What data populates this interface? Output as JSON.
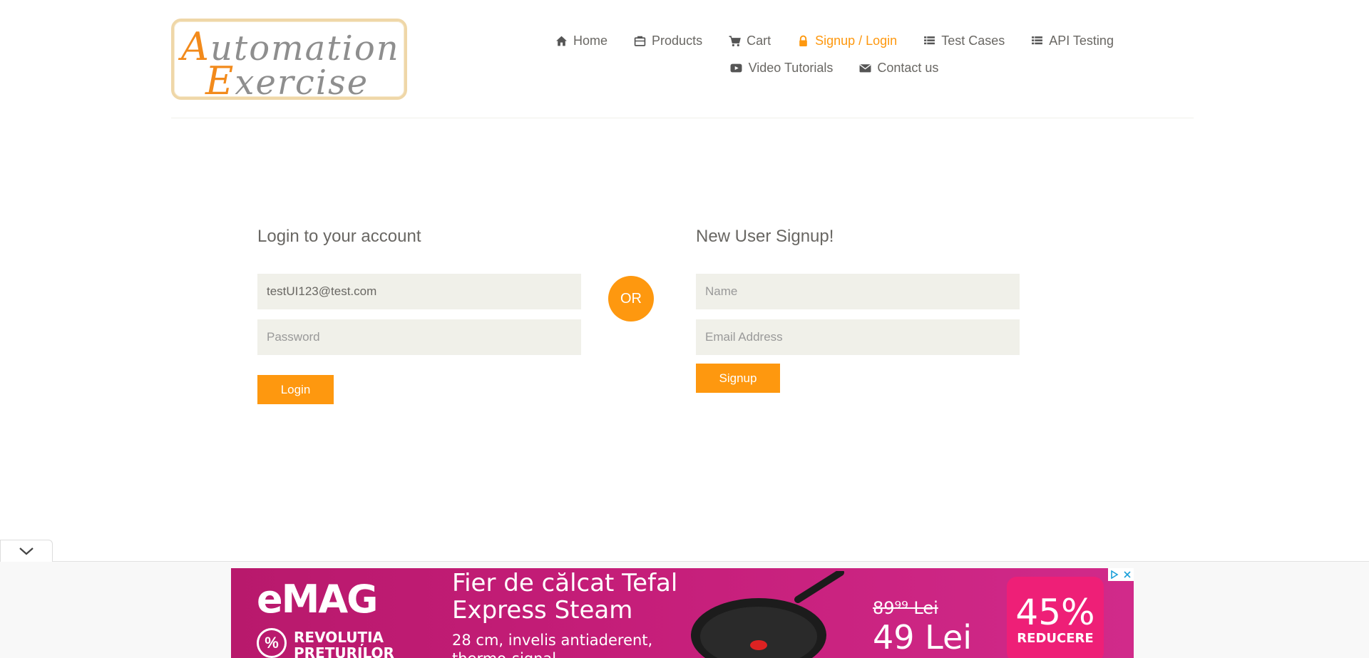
{
  "logo": {
    "line1_cap": "A",
    "line1_rest": "utomation",
    "line2_cap": "E",
    "line2_rest": "xercise"
  },
  "nav": {
    "row1": [
      {
        "label": "Home",
        "icon": "home-icon",
        "active": false
      },
      {
        "label": "Products",
        "icon": "products-icon",
        "active": false
      },
      {
        "label": "Cart",
        "icon": "cart-icon",
        "active": false
      },
      {
        "label": "Signup / Login",
        "icon": "lock-icon",
        "active": true
      },
      {
        "label": "Test Cases",
        "icon": "list-icon",
        "active": false
      },
      {
        "label": "API Testing",
        "icon": "list-icon",
        "active": false
      }
    ],
    "row2": [
      {
        "label": "Video Tutorials",
        "icon": "video-icon",
        "active": false
      },
      {
        "label": "Contact us",
        "icon": "envelope-icon",
        "active": false
      }
    ]
  },
  "login": {
    "title": "Login to your account",
    "email_value": "testUI123@test.com",
    "password_placeholder": "Password",
    "button": "Login"
  },
  "or_label": "OR",
  "signup": {
    "title": "New User Signup!",
    "name_placeholder": "Name",
    "email_placeholder": "Email Address",
    "button": "Signup"
  },
  "ad": {
    "brand": "eMAG",
    "tagline": "REVOLUȚIA PREȚURILOR",
    "headline_line1": "Fier de călcat Tefal",
    "headline_line2": "Express Steam",
    "sub_line1": "28 cm, invelis antiaderent,",
    "sub_line2": "thermo-signal",
    "old_price": "89⁹⁹ Lei",
    "new_price": "49 Lei",
    "discount": "45%",
    "discount_label": "REDUCERE"
  },
  "colors": {
    "accent": "#fe980f",
    "text": "#696763",
    "field_bg": "#f0f0e9",
    "ad_bg": "#c41d78"
  }
}
